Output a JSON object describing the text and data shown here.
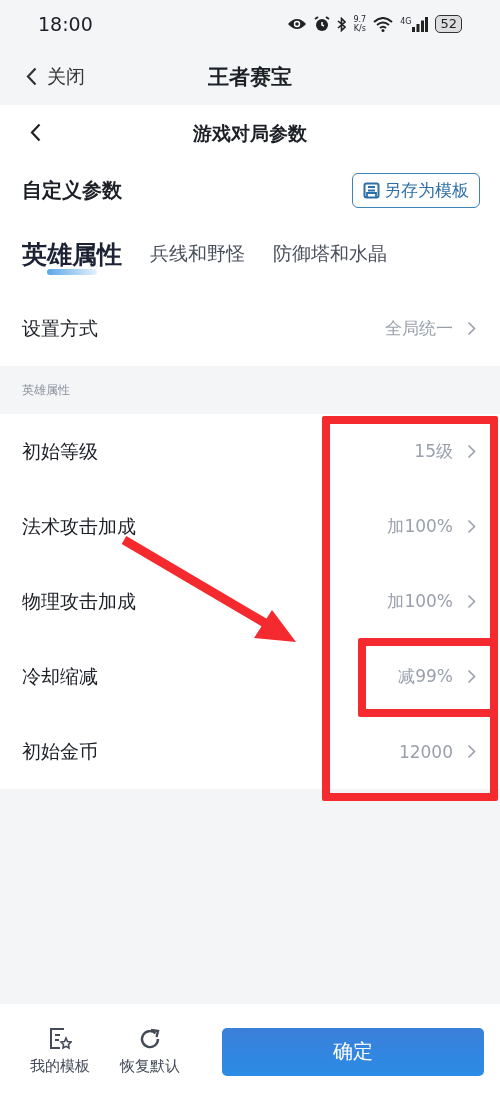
{
  "status_bar": {
    "time": "18:00",
    "speed": "9.7",
    "speed_unit": "K/s",
    "network": "4G",
    "battery": "52"
  },
  "nav": {
    "back_label": "关闭",
    "title": "王者赛宝"
  },
  "page": {
    "title": "游戏对局参数"
  },
  "custom": {
    "label": "自定义参数",
    "save_button": "另存为模板"
  },
  "tabs": [
    {
      "label": "英雄属性",
      "selected": true
    },
    {
      "label": "兵线和野怪",
      "selected": false
    },
    {
      "label": "防御塔和水晶",
      "selected": false
    }
  ],
  "mode": {
    "label": "设置方式",
    "value": "全局统一"
  },
  "section": {
    "title": "英雄属性",
    "values_outlined": true,
    "arrow": true
  },
  "rows": [
    {
      "label": "初始等级",
      "value": "15级",
      "highlighted": false
    },
    {
      "label": "法术攻击加成",
      "value": "加100%",
      "highlighted": false
    },
    {
      "label": "物理攻击加成",
      "value": "加100%",
      "highlighted": false
    },
    {
      "label": "冷却缩减",
      "value": "减99%",
      "highlighted": true
    },
    {
      "label": "初始金币",
      "value": "12000",
      "highlighted": false
    }
  ],
  "bottom": {
    "templates": "我的模板",
    "reset": "恢复默认",
    "confirm": "确定"
  }
}
